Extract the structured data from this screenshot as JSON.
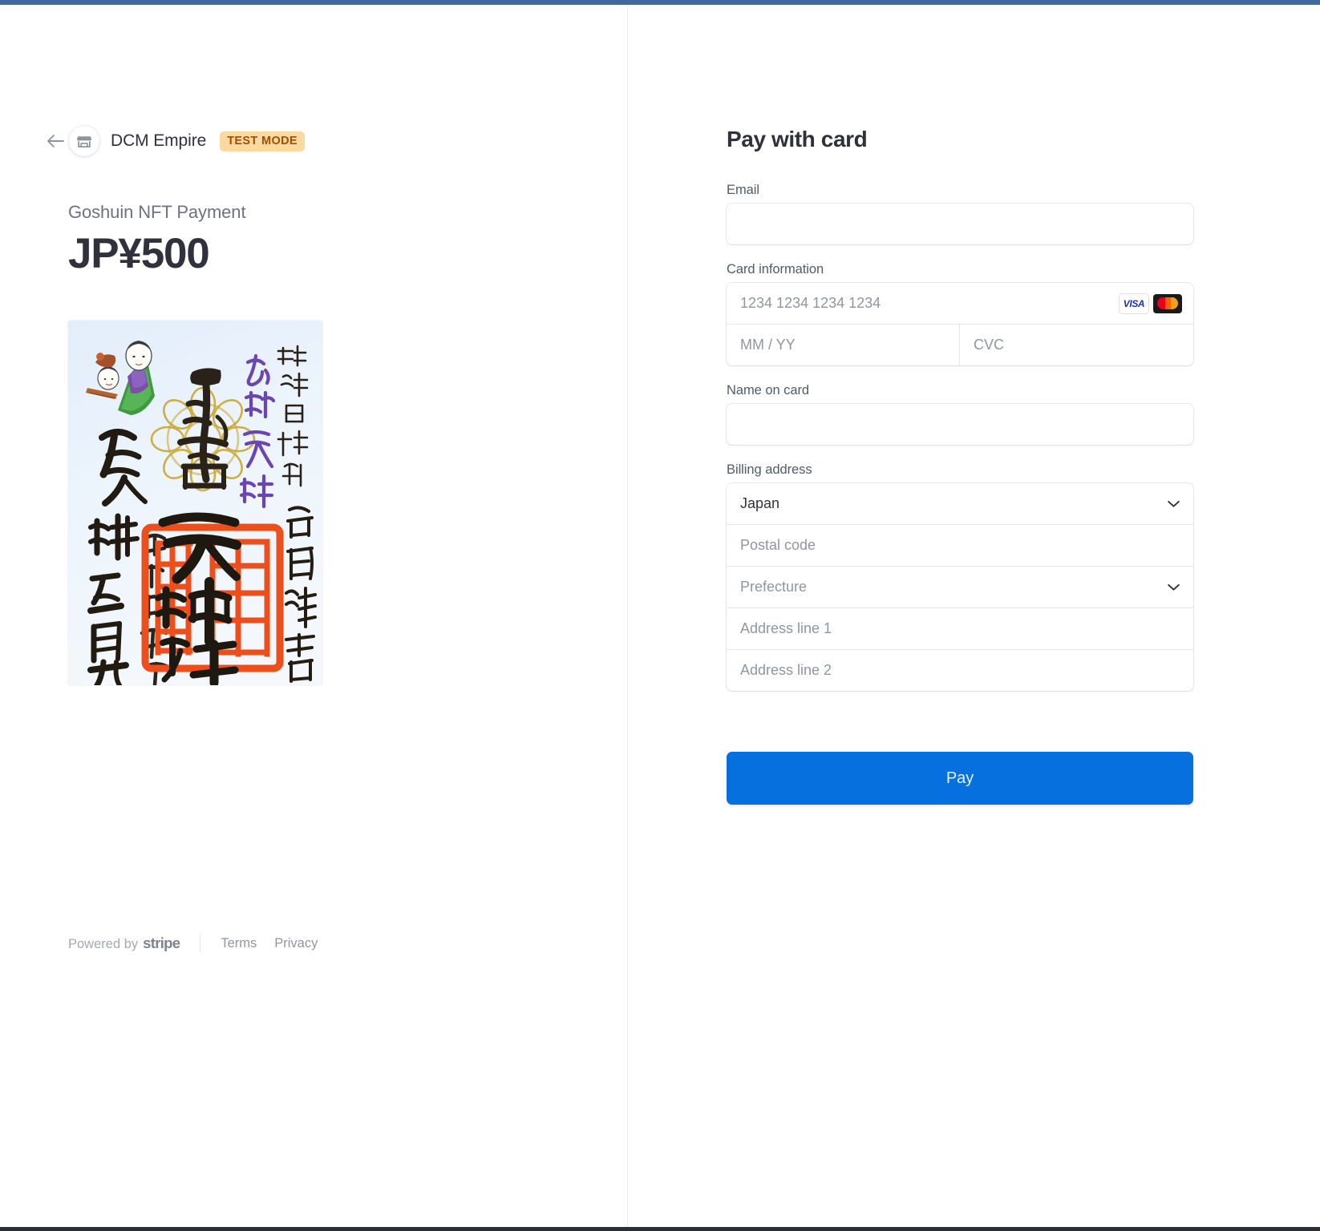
{
  "window": {
    "accent_blue": "#0570de",
    "top_bar_color": "#41699b"
  },
  "summary": {
    "back_icon": "arrow-left-icon",
    "merchant_icon": "storefront-icon",
    "merchant_name": "DCM Empire",
    "test_mode_badge": "TEST MODE",
    "test_mode_bg": "#fcd9a0",
    "test_mode_fg": "#a14e00",
    "product_name": "Goshuin NFT Payment",
    "product_amount": "JP¥500",
    "product_image_alt": "Goshuin shrine seal with Japanese calligraphy, red square stamp and gold chrysanthemum"
  },
  "footer": {
    "powered_by_text": "Powered by",
    "stripe_wordmark": "stripe",
    "links": [
      {
        "label": "Terms"
      },
      {
        "label": "Privacy"
      }
    ]
  },
  "form": {
    "title": "Pay with card",
    "email": {
      "label": "Email",
      "value": "",
      "placeholder": ""
    },
    "card_information": {
      "label": "Card information",
      "number_placeholder": "1234 1234 1234 1234",
      "number_value": "",
      "expiry_placeholder": "MM / YY",
      "expiry_value": "",
      "cvc_placeholder": "CVC",
      "cvc_value": "",
      "brands": [
        {
          "name": "visa-brand-icon",
          "label": "VISA"
        },
        {
          "name": "mastercard-brand-icon",
          "label": "Mastercard"
        }
      ]
    },
    "name_on_card": {
      "label": "Name on card",
      "value": "",
      "placeholder": ""
    },
    "billing_address": {
      "label": "Billing address",
      "country": {
        "selected": "Japan",
        "is_placeholder": false
      },
      "postal_code": {
        "value": "",
        "placeholder": "Postal code"
      },
      "prefecture": {
        "selected": "Prefecture",
        "is_placeholder": true
      },
      "address_line_1": {
        "value": "",
        "placeholder": "Address line 1"
      },
      "address_line_2": {
        "value": "",
        "placeholder": "Address line 2"
      }
    },
    "submit_label": "Pay"
  }
}
